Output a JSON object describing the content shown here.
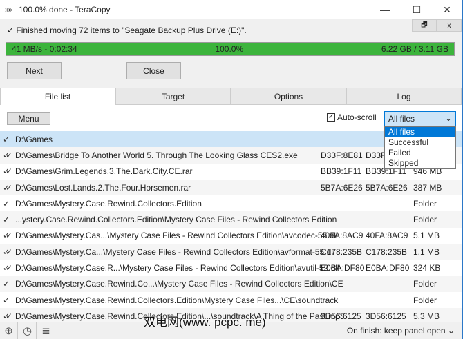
{
  "window": {
    "title": "100.0% done - TeraCopy",
    "logo": "»»»",
    "minimize": "—",
    "maximize": "☐",
    "close": "✕",
    "restore_small": "🗗",
    "close_small": "x"
  },
  "status": {
    "icon": "✓",
    "text": "Finished moving 72 items to \"Seagate Backup Plus Drive (E:)\"."
  },
  "progress": {
    "value_percent": 100,
    "speed_time": "41 MB/s - 0:02:34",
    "percent": "100.0%",
    "size": "6.22 GB / 3.11 GB",
    "color": "#3cb43c"
  },
  "buttons": {
    "next": "Next",
    "close": "Close",
    "menu": "Menu"
  },
  "tabs": [
    {
      "label": "File list"
    },
    {
      "label": "Target"
    },
    {
      "label": "Options"
    },
    {
      "label": "Log"
    }
  ],
  "autoscroll": {
    "label": "Auto-scroll",
    "checked": true,
    "mark": "✓"
  },
  "filter": {
    "selected": "All files",
    "arrow": "⌄",
    "options": [
      "All files",
      "Successful",
      "Failed",
      "Skipped"
    ]
  },
  "rows": [
    {
      "icon": "✓",
      "path": "D:\\Games",
      "h1": "",
      "h2": "",
      "size": ""
    },
    {
      "icon": "✓✓",
      "path": "D:\\Games\\Bridge To Another World 5. Through The Looking Glass CES2.exe",
      "h1": "D33F:8E81",
      "h2": "D33F:8E81",
      "size": ""
    },
    {
      "icon": "✓✓",
      "path": "D:\\Games\\Grim.Legends.3.The.Dark.City.CE.rar",
      "h1": "BB39:1F11",
      "h2": "BB39:1F11",
      "size": "946 MB"
    },
    {
      "icon": "✓✓",
      "path": "D:\\Games\\Lost.Lands.2.The.Four.Horsemen.rar",
      "h1": "5B7A:6E26",
      "h2": "5B7A:6E26",
      "size": "387 MB"
    },
    {
      "icon": "✓",
      "path": "D:\\Games\\Mystery.Case.Rewind.Collectors.Edition",
      "h1": "",
      "h2": "",
      "size": "Folder"
    },
    {
      "icon": "✓",
      "path": "...ystery.Case.Rewind.Collectors.Edition\\Mystery Case Files - Rewind Collectors Edition",
      "h1": "",
      "h2": "",
      "size": "Folder"
    },
    {
      "icon": "✓✓",
      "path": "D:\\Games\\Mystery.Cas...\\Mystery Case Files - Rewind Collectors Edition\\avcodec-55.dll",
      "h1": "40FA:8AC9",
      "h2": "40FA:8AC9",
      "size": "5.1 MB"
    },
    {
      "icon": "✓✓",
      "path": "D:\\Games\\Mystery.Ca...\\Mystery Case Files - Rewind Collectors Edition\\avformat-55.dll",
      "h1": "C178:235B",
      "h2": "C178:235B",
      "size": "1.1 MB"
    },
    {
      "icon": "✓✓",
      "path": "D:\\Games\\Mystery.Case.R...\\Mystery Case Files - Rewind Collectors Edition\\avutil-52.dll",
      "h1": "E0BA:DF80",
      "h2": "E0BA:DF80",
      "size": "324 KB"
    },
    {
      "icon": "✓",
      "path": "D:\\Games\\Mystery.Case.Rewind.Co...\\Mystery Case Files - Rewind Collectors Edition\\CE",
      "h1": "",
      "h2": "",
      "size": "Folder"
    },
    {
      "icon": "✓",
      "path": "D:\\Games\\Mystery.Case.Rewind.Collectors.Edition\\Mystery Case Files...\\CE\\soundtrack",
      "h1": "",
      "h2": "",
      "size": "Folder"
    },
    {
      "icon": "✓✓",
      "path": "D:\\Games\\Mystery.Case.Rewind.Collectors.Edition\\...\\soundtrack\\A Thing of the Past.mp3",
      "h1": "3D56:6125",
      "h2": "3D56:6125",
      "size": "5.3 MB"
    }
  ],
  "bottom": {
    "add": "⊕",
    "history": "◷",
    "list": "≣",
    "on_finish": "On finish: keep panel open ⌄"
  },
  "watermark": "双电网(www. pcpc. me)"
}
